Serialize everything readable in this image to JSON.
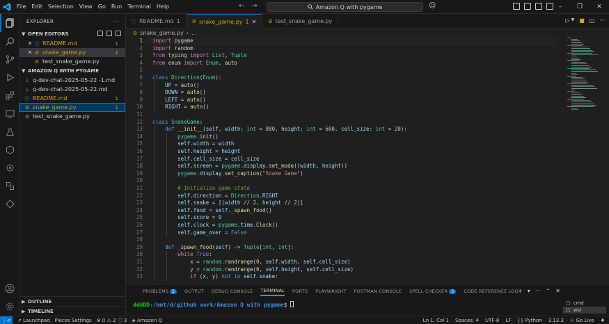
{
  "titlebar": {
    "menu": [
      "File",
      "Edit",
      "Selection",
      "View",
      "Go",
      "Run",
      "Terminal",
      "Help"
    ],
    "search": "Amazon Q with pygame"
  },
  "sidebar": {
    "title": "EXPLORER",
    "open_editors_title": "OPEN EDITORS",
    "open_editors": [
      {
        "label": "README.md",
        "badge": "1",
        "icon": "info-icon"
      },
      {
        "label": "snake_game.py",
        "badge": "1",
        "icon": "python-icon"
      },
      {
        "label": "test_snake_game.py",
        "badge": "",
        "icon": "python-icon"
      }
    ],
    "folder_title": "AMAZON Q WITH PYGAME",
    "files": [
      {
        "label": "q-dev-chat-2025-05-22 -1.md",
        "badge": "",
        "icon": "markdown-icon"
      },
      {
        "label": "q-dev-chat-2025-05-22.md",
        "badge": "",
        "icon": "markdown-icon"
      },
      {
        "label": "README.md",
        "badge": "1",
        "icon": "info-icon"
      },
      {
        "label": "snake_game.py",
        "badge": "1",
        "icon": "python-icon"
      },
      {
        "label": "test_snake_game.py",
        "badge": "",
        "icon": "python-icon"
      }
    ],
    "outline": "OUTLINE",
    "timeline": "TIMELINE"
  },
  "tabs": [
    {
      "label": "README.md",
      "badge": "1"
    },
    {
      "label": "snake_game.py",
      "badge": "1"
    },
    {
      "label": "test_snake_game.py",
      "badge": ""
    }
  ],
  "breadcrumb": {
    "file": "snake_game.py",
    "more": "..."
  },
  "code": {
    "line_numbers": [
      "1",
      "2",
      "3",
      "4",
      "5",
      "6",
      "7",
      "8",
      "9",
      "10",
      "11",
      "12",
      "13",
      "14",
      "15",
      "16",
      "17",
      "18",
      "19",
      "20",
      "21",
      "22",
      "23",
      "24",
      "25",
      "26",
      "27",
      "28",
      "29",
      "30",
      "31",
      "32",
      "33"
    ],
    "lines": [
      [
        [
          "k",
          "import "
        ],
        [
          "t",
          "pygame"
        ]
      ],
      [
        [
          "k",
          "import "
        ],
        [
          "t",
          "random"
        ]
      ],
      [
        [
          "k",
          "from "
        ],
        [
          "t",
          "typing "
        ],
        [
          "k",
          "import "
        ],
        [
          "cls",
          "List"
        ],
        [
          "t",
          ", "
        ],
        [
          "cls",
          "Tuple"
        ]
      ],
      [
        [
          "k",
          "from "
        ],
        [
          "t",
          "enum "
        ],
        [
          "k",
          "import "
        ],
        [
          "cls",
          "Enum"
        ],
        [
          "t",
          ", "
        ],
        [
          "fn",
          "auto"
        ]
      ],
      [],
      [
        [
          "kb",
          "class "
        ],
        [
          "cls",
          "Direction"
        ],
        [
          "t",
          "("
        ],
        [
          "cls",
          "Enum"
        ],
        [
          "t",
          "):"
        ]
      ],
      [
        [
          "t",
          "    "
        ],
        [
          "v",
          "UP"
        ],
        [
          "t",
          " = "
        ],
        [
          "fn",
          "auto"
        ],
        [
          "t",
          "()"
        ]
      ],
      [
        [
          "t",
          "    "
        ],
        [
          "v",
          "DOWN"
        ],
        [
          "t",
          " = "
        ],
        [
          "fn",
          "auto"
        ],
        [
          "t",
          "()"
        ]
      ],
      [
        [
          "t",
          "    "
        ],
        [
          "v",
          "LEFT"
        ],
        [
          "t",
          " = "
        ],
        [
          "fn",
          "auto"
        ],
        [
          "t",
          "()"
        ]
      ],
      [
        [
          "t",
          "    "
        ],
        [
          "v",
          "RIGHT"
        ],
        [
          "t",
          " = "
        ],
        [
          "fn",
          "auto"
        ],
        [
          "t",
          "()"
        ]
      ],
      [],
      [
        [
          "kb",
          "class "
        ],
        [
          "cls",
          "SnakeGame"
        ],
        [
          "t",
          ":"
        ]
      ],
      [
        [
          "t",
          "    "
        ],
        [
          "kb",
          "def "
        ],
        [
          "fn",
          "__init__"
        ],
        [
          "t",
          "("
        ],
        [
          "v",
          "self"
        ],
        [
          "t",
          ", "
        ],
        [
          "v",
          "width"
        ],
        [
          "t",
          ": "
        ],
        [
          "cls",
          "int"
        ],
        [
          "t",
          " = "
        ],
        [
          "n",
          "800"
        ],
        [
          "t",
          ", "
        ],
        [
          "v",
          "height"
        ],
        [
          "t",
          ": "
        ],
        [
          "cls",
          "int"
        ],
        [
          "t",
          " = "
        ],
        [
          "n",
          "600"
        ],
        [
          "t",
          ", "
        ],
        [
          "v",
          "cell_size"
        ],
        [
          "t",
          ": "
        ],
        [
          "cls",
          "int"
        ],
        [
          "t",
          " = "
        ],
        [
          "n",
          "20"
        ],
        [
          "t",
          "):"
        ]
      ],
      [
        [
          "t",
          "        "
        ],
        [
          "cls",
          "pygame"
        ],
        [
          "t",
          "."
        ],
        [
          "fn",
          "init"
        ],
        [
          "t",
          "()"
        ]
      ],
      [
        [
          "t",
          "        "
        ],
        [
          "v",
          "self"
        ],
        [
          "t",
          "."
        ],
        [
          "v",
          "width"
        ],
        [
          "t",
          " = "
        ],
        [
          "v",
          "width"
        ]
      ],
      [
        [
          "t",
          "        "
        ],
        [
          "v",
          "self"
        ],
        [
          "t",
          "."
        ],
        [
          "v",
          "height"
        ],
        [
          "t",
          " = "
        ],
        [
          "v",
          "height"
        ]
      ],
      [
        [
          "t",
          "        "
        ],
        [
          "v",
          "self"
        ],
        [
          "t",
          "."
        ],
        [
          "v",
          "cell_size"
        ],
        [
          "t",
          " = "
        ],
        [
          "v",
          "cell_size"
        ]
      ],
      [
        [
          "t",
          "        "
        ],
        [
          "v",
          "self"
        ],
        [
          "t",
          "."
        ],
        [
          "v",
          "screen"
        ],
        [
          "t",
          " = "
        ],
        [
          "cls",
          "pygame"
        ],
        [
          "t",
          "."
        ],
        [
          "v",
          "display"
        ],
        [
          "t",
          "."
        ],
        [
          "fn",
          "set_mode"
        ],
        [
          "t",
          "(("
        ],
        [
          "v",
          "width"
        ],
        [
          "t",
          ", "
        ],
        [
          "v",
          "height"
        ],
        [
          "t",
          "))"
        ]
      ],
      [
        [
          "t",
          "        "
        ],
        [
          "cls",
          "pygame"
        ],
        [
          "t",
          "."
        ],
        [
          "v",
          "display"
        ],
        [
          "t",
          "."
        ],
        [
          "fn",
          "set_caption"
        ],
        [
          "t",
          "("
        ],
        [
          "s",
          "\"Snake Game\""
        ],
        [
          "t",
          ")"
        ]
      ],
      [],
      [
        [
          "t",
          "        "
        ],
        [
          "cm",
          "# Initialize game state"
        ]
      ],
      [
        [
          "t",
          "        "
        ],
        [
          "v",
          "self"
        ],
        [
          "t",
          "."
        ],
        [
          "v",
          "direction"
        ],
        [
          "t",
          " = "
        ],
        [
          "cls",
          "Direction"
        ],
        [
          "t",
          "."
        ],
        [
          "v",
          "RIGHT"
        ]
      ],
      [
        [
          "t",
          "        "
        ],
        [
          "v",
          "self"
        ],
        [
          "t",
          "."
        ],
        [
          "v",
          "snake"
        ],
        [
          "t",
          " = [("
        ],
        [
          "v",
          "width"
        ],
        [
          "t",
          " // "
        ],
        [
          "n",
          "2"
        ],
        [
          "t",
          ", "
        ],
        [
          "v",
          "height"
        ],
        [
          "t",
          " // "
        ],
        [
          "n",
          "2"
        ],
        [
          "t",
          ")]"
        ]
      ],
      [
        [
          "t",
          "        "
        ],
        [
          "v",
          "self"
        ],
        [
          "t",
          "."
        ],
        [
          "v",
          "food"
        ],
        [
          "t",
          " = "
        ],
        [
          "v",
          "self"
        ],
        [
          "t",
          "."
        ],
        [
          "fn",
          "_spawn_food"
        ],
        [
          "t",
          "()"
        ]
      ],
      [
        [
          "t",
          "        "
        ],
        [
          "v",
          "self"
        ],
        [
          "t",
          "."
        ],
        [
          "v",
          "score"
        ],
        [
          "t",
          " = "
        ],
        [
          "n",
          "0"
        ]
      ],
      [
        [
          "t",
          "        "
        ],
        [
          "v",
          "self"
        ],
        [
          "t",
          "."
        ],
        [
          "v",
          "clock"
        ],
        [
          "t",
          " = "
        ],
        [
          "cls",
          "pygame"
        ],
        [
          "t",
          "."
        ],
        [
          "v",
          "time"
        ],
        [
          "t",
          "."
        ],
        [
          "fn",
          "Clock"
        ],
        [
          "t",
          "()"
        ]
      ],
      [
        [
          "t",
          "        "
        ],
        [
          "v",
          "self"
        ],
        [
          "t",
          "."
        ],
        [
          "v",
          "game_over"
        ],
        [
          "t",
          " = "
        ],
        [
          "kb",
          "False"
        ]
      ],
      [],
      [
        [
          "t",
          "    "
        ],
        [
          "kb",
          "def "
        ],
        [
          "fn",
          "_spawn_food"
        ],
        [
          "t",
          "("
        ],
        [
          "v",
          "self"
        ],
        [
          "t",
          ") -> "
        ],
        [
          "cls",
          "Tuple"
        ],
        [
          "t",
          "["
        ],
        [
          "cls",
          "int"
        ],
        [
          "t",
          ", "
        ],
        [
          "cls",
          "int"
        ],
        [
          "t",
          "]:"
        ]
      ],
      [
        [
          "t",
          "        "
        ],
        [
          "k",
          "while "
        ],
        [
          "kb",
          "True"
        ],
        [
          "t",
          ":"
        ]
      ],
      [
        [
          "t",
          "            "
        ],
        [
          "v",
          "x"
        ],
        [
          "t",
          " = "
        ],
        [
          "cls",
          "random"
        ],
        [
          "t",
          "."
        ],
        [
          "fn",
          "randrange"
        ],
        [
          "t",
          "("
        ],
        [
          "n",
          "0"
        ],
        [
          "t",
          ", "
        ],
        [
          "v",
          "self"
        ],
        [
          "t",
          "."
        ],
        [
          "v",
          "width"
        ],
        [
          "t",
          ", "
        ],
        [
          "v",
          "self"
        ],
        [
          "t",
          "."
        ],
        [
          "v",
          "cell_size"
        ],
        [
          "t",
          ")"
        ]
      ],
      [
        [
          "t",
          "            "
        ],
        [
          "v",
          "y"
        ],
        [
          "t",
          " = "
        ],
        [
          "cls",
          "random"
        ],
        [
          "t",
          "."
        ],
        [
          "fn",
          "randrange"
        ],
        [
          "t",
          "("
        ],
        [
          "n",
          "0"
        ],
        [
          "t",
          ", "
        ],
        [
          "v",
          "self"
        ],
        [
          "t",
          "."
        ],
        [
          "v",
          "height"
        ],
        [
          "t",
          ", "
        ],
        [
          "v",
          "self"
        ],
        [
          "t",
          "."
        ],
        [
          "v",
          "cell_size"
        ],
        [
          "t",
          ")"
        ]
      ],
      [
        [
          "t",
          "            "
        ],
        [
          "k",
          "if "
        ],
        [
          "t",
          "("
        ],
        [
          "v",
          "x"
        ],
        [
          "t",
          ", "
        ],
        [
          "v",
          "y"
        ],
        [
          "t",
          ") "
        ],
        [
          "kb",
          "not in "
        ],
        [
          "v",
          "self"
        ],
        [
          "t",
          "."
        ],
        [
          "v",
          "snake"
        ],
        [
          "t",
          ":"
        ]
      ]
    ]
  },
  "panel": {
    "tabs": [
      {
        "label": "PROBLEMS",
        "count": "5"
      },
      {
        "label": "OUTPUT",
        "count": ""
      },
      {
        "label": "DEBUG CONSOLE",
        "count": ""
      },
      {
        "label": "TERMINAL",
        "count": ""
      },
      {
        "label": "PORTS",
        "count": ""
      },
      {
        "label": "PLAYWRIGHT",
        "count": ""
      },
      {
        "label": "POSTMAN CONSOLE",
        "count": ""
      },
      {
        "label": "SPELL CHECKER",
        "count": "3"
      },
      {
        "label": "CODE REFERENCE LOG",
        "count": ""
      }
    ],
    "active_tab": "TERMINAL",
    "terminal_user": "dd@DD",
    "terminal_path": ":/mnt/d/github work/Amazon Q with pygame",
    "terminal_prompt": "$ ",
    "terminal_list": [
      "cmd",
      "wsl"
    ]
  },
  "statusbar": {
    "launchpad": "Launchpad",
    "pieces": "Pieces Settings",
    "problems": "⊗ 0 ⚠ 2 ⓘ 3",
    "amazonq": "Amazon Q",
    "position": "Ln 1, Col 1",
    "spaces": "Spaces: 4",
    "encoding": "UTF-8",
    "eol": "LF",
    "language": "{} Python",
    "version": "3.13.3",
    "golive": "Go Live"
  }
}
